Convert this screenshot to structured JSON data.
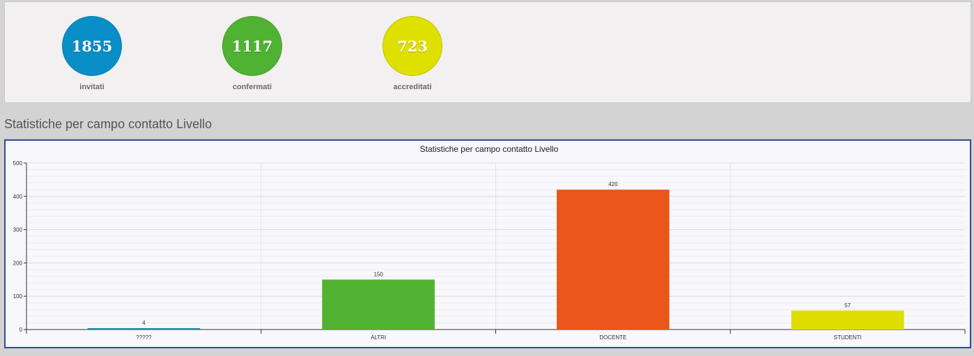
{
  "stats": [
    {
      "value": "1855",
      "label": "invitati",
      "color": "#0a8ec8"
    },
    {
      "value": "1117",
      "label": "confermati",
      "color": "#4fb232"
    },
    {
      "value": "723",
      "label": "accreditati",
      "color": "#dfdf00"
    }
  ],
  "section_title": "Statistiche per campo contatto Livello",
  "chart_data": {
    "type": "bar",
    "title": "Statistiche per campo contatto Livello",
    "categories": [
      "?????",
      "ALTRI",
      "DOCENTE",
      "STUDENTI"
    ],
    "values": [
      4,
      150,
      420,
      57
    ],
    "colors": [
      "#1f8aa6",
      "#52b232",
      "#ea561c",
      "#dede00"
    ],
    "ylim": [
      0,
      500
    ],
    "yticks": [
      0,
      100,
      200,
      300,
      400,
      500
    ],
    "xlabel": "",
    "ylabel": "",
    "grid": true,
    "data_labels": true
  }
}
